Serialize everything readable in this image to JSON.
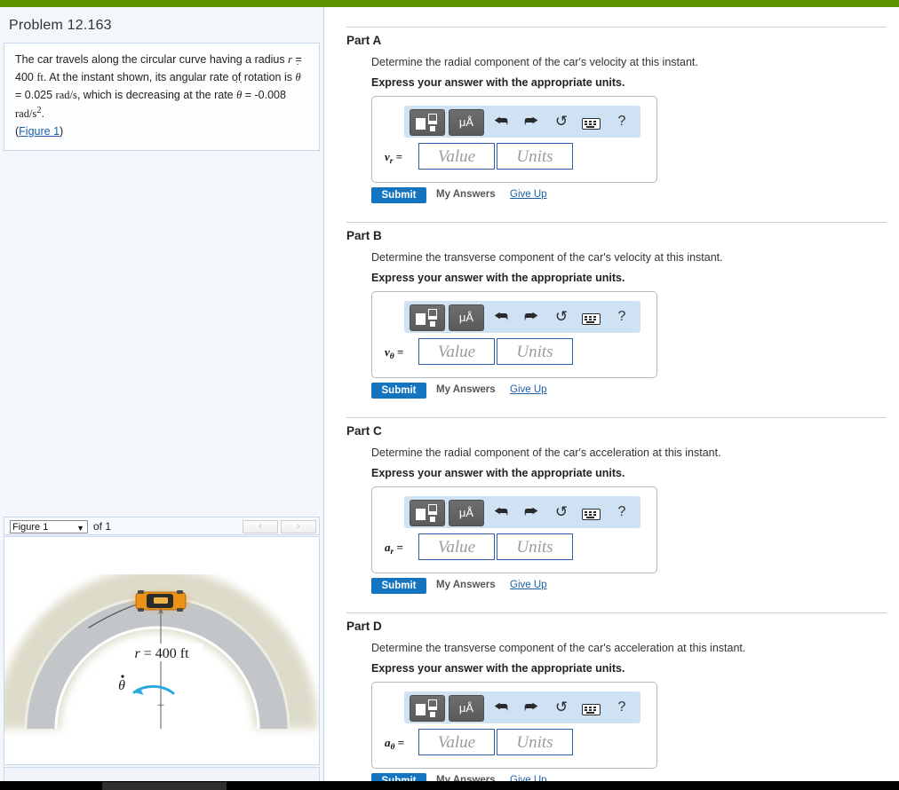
{
  "colors": {
    "top_bar_green": "#5f9200",
    "submit_blue": "#1474bf",
    "link_blue": "#1a5fa8",
    "toolbar_blue": "#cfe2f3",
    "input_border": "#2f5fa8",
    "road_grey": "#c3c6c8",
    "shoulder_tan": "#dddbc9",
    "car_orange": "#eb9113",
    "arrow_blue": "#29abe2"
  },
  "problem": {
    "title": "Problem 12.163",
    "text_part1": "The car travels along the circular curve having a radius ",
    "radius_symbol": "r",
    "text_part2": " = 400 ",
    "unit_ft": "ft",
    "text_part3": ". At the instant shown, its angular rate of rotation is ",
    "theta_symbol": "θ",
    "theta_dot_dots": "·",
    "text_part4": " = 0.025 ",
    "unit_rads": "rad/s",
    "text_part5": ", which is decreasing at the rate ",
    "theta_ddot_dots": "··",
    "text_part6": " = -0.008 ",
    "unit_rads2_base": "rad/s",
    "unit_rads2_exp": "2",
    "text_part7": ".",
    "figure_link": "Figure 1",
    "paren_open": "(",
    "paren_close": ")"
  },
  "figure_viewer": {
    "select_value": "Figure 1",
    "dropdown_arrow": "▼",
    "of_label": "of 1",
    "prev_arrow": "‹",
    "next_arrow": "›",
    "radius_label": "r = 400 ft",
    "radius_var": "r",
    "radius_eq": " = 400 ",
    "radius_unit": "ft",
    "theta_dot_label": "θ",
    "center_mark": "+"
  },
  "toolbar": {
    "template_button_name": "template",
    "units_button_label": "μÅ",
    "undo_glyph": "⮪",
    "redo_glyph": "⮫",
    "reset_glyph": "↺",
    "help_glyph": "?"
  },
  "actions": {
    "submit_label": "Submit",
    "my_answers_label": "My Answers",
    "give_up_label": "Give Up"
  },
  "inputs": {
    "value_placeholder": "Value",
    "units_placeholder": "Units"
  },
  "parts": [
    {
      "title": "Part A",
      "question": "Determine the radial component of the car's velocity at this instant.",
      "instruction": "Express your answer with the appropriate units.",
      "var_base": "v",
      "var_sub": "r",
      "var_eq": " ="
    },
    {
      "title": "Part B",
      "question": "Determine the transverse component of the car's velocity at this instant.",
      "instruction": "Express your answer with the appropriate units.",
      "var_base": "v",
      "var_sub": "θ",
      "var_eq": " ="
    },
    {
      "title": "Part C",
      "question": "Determine the radial component of the car's acceleration at this instant.",
      "instruction": "Express your answer with the appropriate units.",
      "var_base": "a",
      "var_sub": "r",
      "var_eq": " ="
    },
    {
      "title": "Part D",
      "question": "Determine the transverse component of the car's acceleration at this instant.",
      "instruction": "Express your answer with the appropriate units.",
      "var_base": "a",
      "var_sub": "θ",
      "var_eq": " ="
    }
  ]
}
